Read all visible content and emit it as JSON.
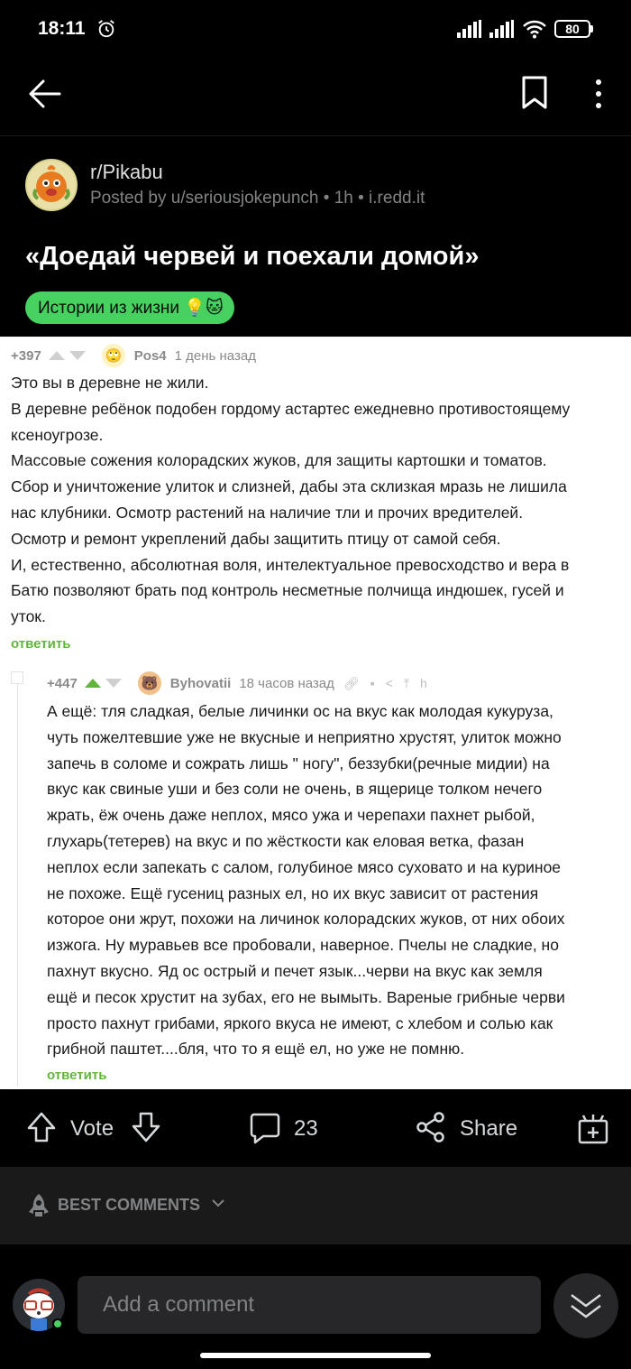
{
  "status_bar": {
    "time": "18:11",
    "battery": "80"
  },
  "post": {
    "subreddit": "r/Pikabu",
    "posted_by": "Posted by u/seriousjokepunch • 1h • i.redd.it",
    "title": "«Доедай червей и поехали домой»",
    "flair": "Истории из жизни 💡🐱"
  },
  "image": {
    "comment1": {
      "score": "+397",
      "user": "Pos4",
      "time": "1 день назад",
      "lines": [
        "Это вы в деревне не жили.",
        "В деревне ребёнок подобен гордому астартес ежедневно противостоящему",
        "ксеноугрозе.",
        "Массовые сожения колорадских жуков, для защиты картошки и томатов.",
        "Сбор и уничтожение улиток и слизней, дабы эта склизкая мразь не лишила",
        "нас клубники. Осмотр растений на наличие тли и прочих вредителей.",
        "Осмотр и ремонт укреплений дабы защитить птицу от самой себя.",
        "И, естественно, абсолютная воля, интелектуальное превосходство и вера в",
        "Батю позволяют брать под контроль несметные полчища индюшек, гусей и",
        "уток."
      ],
      "reply": "ответить"
    },
    "comment2": {
      "score": "+447",
      "user": "Byhovatii",
      "time": "18 часов назад",
      "lines": [
        "А ещё: тля сладкая, белые личинки ос на вкус как молодая кукуруза,",
        "чуть пожелтевшие уже не вкусные и неприятно хрустят, улиток можно",
        "запечь в соломе и сожрать лишь \" ногу\", беззубки(речные мидии) на",
        "вкус как свиные уши и без соли не очень, в ящерице толком нечего",
        "жрать, ёж очень даже неплох, мясо ужа и черепахи пахнет рыбой,",
        "глухарь(тетерев) на вкус и по жёсткости как еловая ветка, фазан",
        "неплох если запекать с салом, голубиное мясо суховато и на куриное",
        "не похоже. Ещё гусениц разных ел, но их вкус зависит от растения",
        "которое они жрут, похожи на личинок колорадских жуков, от них обоих",
        "изжога. Ну муравьев все пробовали, наверное. Пчелы не сладкие, но",
        "пахнут вкусно. Яд ос острый и печет язык...черви на вкус как земля",
        "ещё и песок хрустит на зубах, его не вымыть. Вареные грибные черви",
        "просто пахнут грибами, яркого вкуса не имеют, с хлебом и солью как",
        "грибной паштет....бля, что то я ещё ел, но уже не помню."
      ],
      "reply": "ответить"
    }
  },
  "actions": {
    "vote": "Vote",
    "comments_count": "23",
    "share": "Share"
  },
  "sort": {
    "label": "BEST COMMENTS"
  },
  "composer": {
    "placeholder": "Add a comment"
  },
  "colors": {
    "accent_green": "#46d160",
    "background": "#000000",
    "panel": "#1a1a1b"
  }
}
